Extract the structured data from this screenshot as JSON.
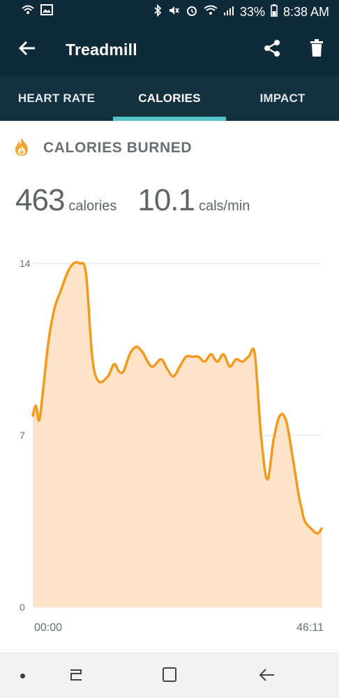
{
  "status_bar": {
    "battery": "33%",
    "time": "8:38 AM",
    "icons": [
      "wifi-call-icon",
      "image-icon",
      "bluetooth-icon",
      "mute-icon",
      "alarm-icon",
      "wifi-icon",
      "signal-icon",
      "battery-icon"
    ]
  },
  "app_bar": {
    "title": "Treadmill",
    "back_icon": "arrow-left-icon",
    "share_icon": "share-icon",
    "delete_icon": "trash-icon"
  },
  "tabs": [
    {
      "label": "HEART RATE",
      "active": false
    },
    {
      "label": "CALORIES",
      "active": true
    },
    {
      "label": "IMPACT",
      "active": false
    }
  ],
  "section": {
    "title": "CALORIES BURNED",
    "icon": "flame-icon"
  },
  "stats": {
    "total_value": "463",
    "total_unit": "calories",
    "rate_value": "10.1",
    "rate_unit": "cals/min"
  },
  "colors": {
    "primary_dark": "#0f2a38",
    "tabs_bg": "#14313f",
    "tab_indicator": "#56c3c7",
    "line": "#f39a1e",
    "fill": "#fde3c8",
    "flame_outer": "#f0a433",
    "flame_inner": "#f6c24d"
  },
  "chart_data": {
    "type": "area",
    "x_unit": "minutes",
    "x_tick_labels": [
      "00:00",
      "46:11"
    ],
    "y_tick_labels": [
      "14",
      "7",
      "0"
    ],
    "ylim": [
      0,
      14
    ],
    "xlim": [
      0,
      46.18
    ],
    "grid": true,
    "x": [
      0,
      0.5,
      1.0,
      1.5,
      2.5,
      3.5,
      4.5,
      5.5,
      6.5,
      7.5,
      8.5,
      9.5,
      10.5,
      12.0,
      13.0,
      13.8,
      14.5,
      15.5,
      16.5,
      17.5,
      19.0,
      20.5,
      21.5,
      22.5,
      23.5,
      24.5,
      25.5,
      26.5,
      27.5,
      28.5,
      29.5,
      30.5,
      31.5,
      32.5,
      33.5,
      34.5,
      35.5,
      36.5,
      37.5,
      38.5,
      39.5,
      40.5,
      41.5,
      42.5,
      43.0,
      43.5,
      44.5,
      45.5,
      46.18
    ],
    "values": [
      7.8,
      8.2,
      7.6,
      8.5,
      10.8,
      12.2,
      12.9,
      13.6,
      14.0,
      14.0,
      13.6,
      10.2,
      9.2,
      9.4,
      9.9,
      9.6,
      9.6,
      10.3,
      10.6,
      10.4,
      9.8,
      10.1,
      9.7,
      9.4,
      9.8,
      10.2,
      10.2,
      10.2,
      10.0,
      10.3,
      10.0,
      10.3,
      9.8,
      10.1,
      10.0,
      10.2,
      10.3,
      7.0,
      5.2,
      6.8,
      7.8,
      7.6,
      6.2,
      4.6,
      4.0,
      3.5,
      3.2,
      3.0,
      3.2
    ]
  }
}
